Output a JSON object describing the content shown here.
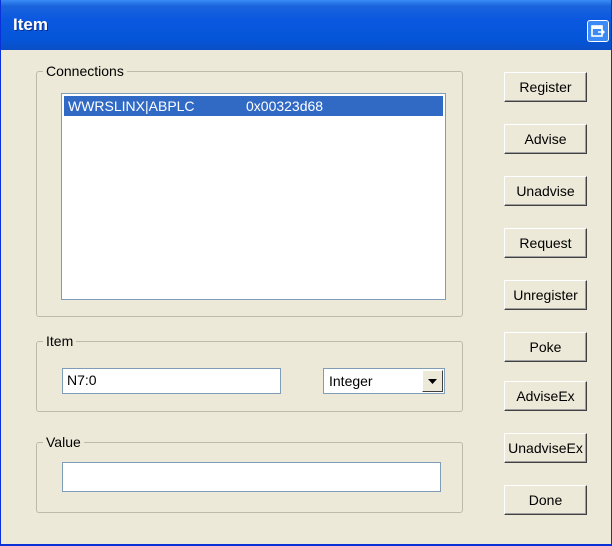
{
  "window": {
    "title": "Item"
  },
  "connections": {
    "legend": "Connections",
    "items": [
      {
        "name": "WWRSLINX|ABPLC",
        "handle": "0x00323d68"
      }
    ]
  },
  "item": {
    "legend": "Item",
    "value": "N7:0",
    "type": {
      "selected": "Integer"
    }
  },
  "value_group": {
    "legend": "Value",
    "value": ""
  },
  "buttons": {
    "register": "Register",
    "advise": "Advise",
    "unadvise": "Unadvise",
    "request": "Request",
    "unregister": "Unregister",
    "poke": "Poke",
    "advise_ex": "AdviseEx",
    "unadvise_ex": "UnadviseEx",
    "done": "Done"
  },
  "icons": {
    "titlebar_button": "window-button-icon",
    "combo_arrow": "chevron-down-icon"
  },
  "colors": {
    "titlebar": "#0a58e0",
    "selection": "#316ac5",
    "face": "#ece9d8"
  }
}
